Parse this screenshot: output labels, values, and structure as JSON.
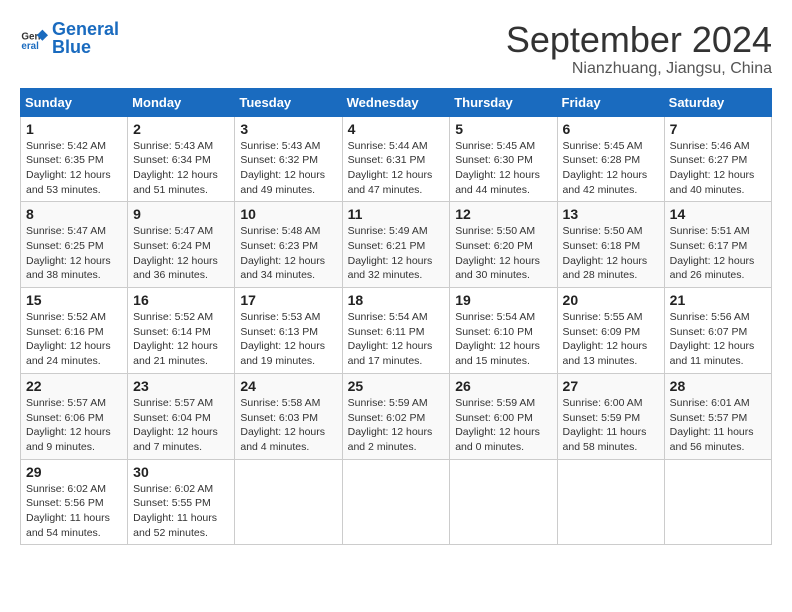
{
  "header": {
    "logo_general": "General",
    "logo_blue": "Blue",
    "month": "September 2024",
    "location": "Nianzhuang, Jiangsu, China"
  },
  "columns": [
    "Sunday",
    "Monday",
    "Tuesday",
    "Wednesday",
    "Thursday",
    "Friday",
    "Saturday"
  ],
  "weeks": [
    [
      {
        "day": "1",
        "info": "Sunrise: 5:42 AM\nSunset: 6:35 PM\nDaylight: 12 hours\nand 53 minutes."
      },
      {
        "day": "2",
        "info": "Sunrise: 5:43 AM\nSunset: 6:34 PM\nDaylight: 12 hours\nand 51 minutes."
      },
      {
        "day": "3",
        "info": "Sunrise: 5:43 AM\nSunset: 6:32 PM\nDaylight: 12 hours\nand 49 minutes."
      },
      {
        "day": "4",
        "info": "Sunrise: 5:44 AM\nSunset: 6:31 PM\nDaylight: 12 hours\nand 47 minutes."
      },
      {
        "day": "5",
        "info": "Sunrise: 5:45 AM\nSunset: 6:30 PM\nDaylight: 12 hours\nand 44 minutes."
      },
      {
        "day": "6",
        "info": "Sunrise: 5:45 AM\nSunset: 6:28 PM\nDaylight: 12 hours\nand 42 minutes."
      },
      {
        "day": "7",
        "info": "Sunrise: 5:46 AM\nSunset: 6:27 PM\nDaylight: 12 hours\nand 40 minutes."
      }
    ],
    [
      {
        "day": "8",
        "info": "Sunrise: 5:47 AM\nSunset: 6:25 PM\nDaylight: 12 hours\nand 38 minutes."
      },
      {
        "day": "9",
        "info": "Sunrise: 5:47 AM\nSunset: 6:24 PM\nDaylight: 12 hours\nand 36 minutes."
      },
      {
        "day": "10",
        "info": "Sunrise: 5:48 AM\nSunset: 6:23 PM\nDaylight: 12 hours\nand 34 minutes."
      },
      {
        "day": "11",
        "info": "Sunrise: 5:49 AM\nSunset: 6:21 PM\nDaylight: 12 hours\nand 32 minutes."
      },
      {
        "day": "12",
        "info": "Sunrise: 5:50 AM\nSunset: 6:20 PM\nDaylight: 12 hours\nand 30 minutes."
      },
      {
        "day": "13",
        "info": "Sunrise: 5:50 AM\nSunset: 6:18 PM\nDaylight: 12 hours\nand 28 minutes."
      },
      {
        "day": "14",
        "info": "Sunrise: 5:51 AM\nSunset: 6:17 PM\nDaylight: 12 hours\nand 26 minutes."
      }
    ],
    [
      {
        "day": "15",
        "info": "Sunrise: 5:52 AM\nSunset: 6:16 PM\nDaylight: 12 hours\nand 24 minutes."
      },
      {
        "day": "16",
        "info": "Sunrise: 5:52 AM\nSunset: 6:14 PM\nDaylight: 12 hours\nand 21 minutes."
      },
      {
        "day": "17",
        "info": "Sunrise: 5:53 AM\nSunset: 6:13 PM\nDaylight: 12 hours\nand 19 minutes."
      },
      {
        "day": "18",
        "info": "Sunrise: 5:54 AM\nSunset: 6:11 PM\nDaylight: 12 hours\nand 17 minutes."
      },
      {
        "day": "19",
        "info": "Sunrise: 5:54 AM\nSunset: 6:10 PM\nDaylight: 12 hours\nand 15 minutes."
      },
      {
        "day": "20",
        "info": "Sunrise: 5:55 AM\nSunset: 6:09 PM\nDaylight: 12 hours\nand 13 minutes."
      },
      {
        "day": "21",
        "info": "Sunrise: 5:56 AM\nSunset: 6:07 PM\nDaylight: 12 hours\nand 11 minutes."
      }
    ],
    [
      {
        "day": "22",
        "info": "Sunrise: 5:57 AM\nSunset: 6:06 PM\nDaylight: 12 hours\nand 9 minutes."
      },
      {
        "day": "23",
        "info": "Sunrise: 5:57 AM\nSunset: 6:04 PM\nDaylight: 12 hours\nand 7 minutes."
      },
      {
        "day": "24",
        "info": "Sunrise: 5:58 AM\nSunset: 6:03 PM\nDaylight: 12 hours\nand 4 minutes."
      },
      {
        "day": "25",
        "info": "Sunrise: 5:59 AM\nSunset: 6:02 PM\nDaylight: 12 hours\nand 2 minutes."
      },
      {
        "day": "26",
        "info": "Sunrise: 5:59 AM\nSunset: 6:00 PM\nDaylight: 12 hours\nand 0 minutes."
      },
      {
        "day": "27",
        "info": "Sunrise: 6:00 AM\nSunset: 5:59 PM\nDaylight: 11 hours\nand 58 minutes."
      },
      {
        "day": "28",
        "info": "Sunrise: 6:01 AM\nSunset: 5:57 PM\nDaylight: 11 hours\nand 56 minutes."
      }
    ],
    [
      {
        "day": "29",
        "info": "Sunrise: 6:02 AM\nSunset: 5:56 PM\nDaylight: 11 hours\nand 54 minutes."
      },
      {
        "day": "30",
        "info": "Sunrise: 6:02 AM\nSunset: 5:55 PM\nDaylight: 11 hours\nand 52 minutes."
      },
      {
        "day": "",
        "info": ""
      },
      {
        "day": "",
        "info": ""
      },
      {
        "day": "",
        "info": ""
      },
      {
        "day": "",
        "info": ""
      },
      {
        "day": "",
        "info": ""
      }
    ]
  ]
}
